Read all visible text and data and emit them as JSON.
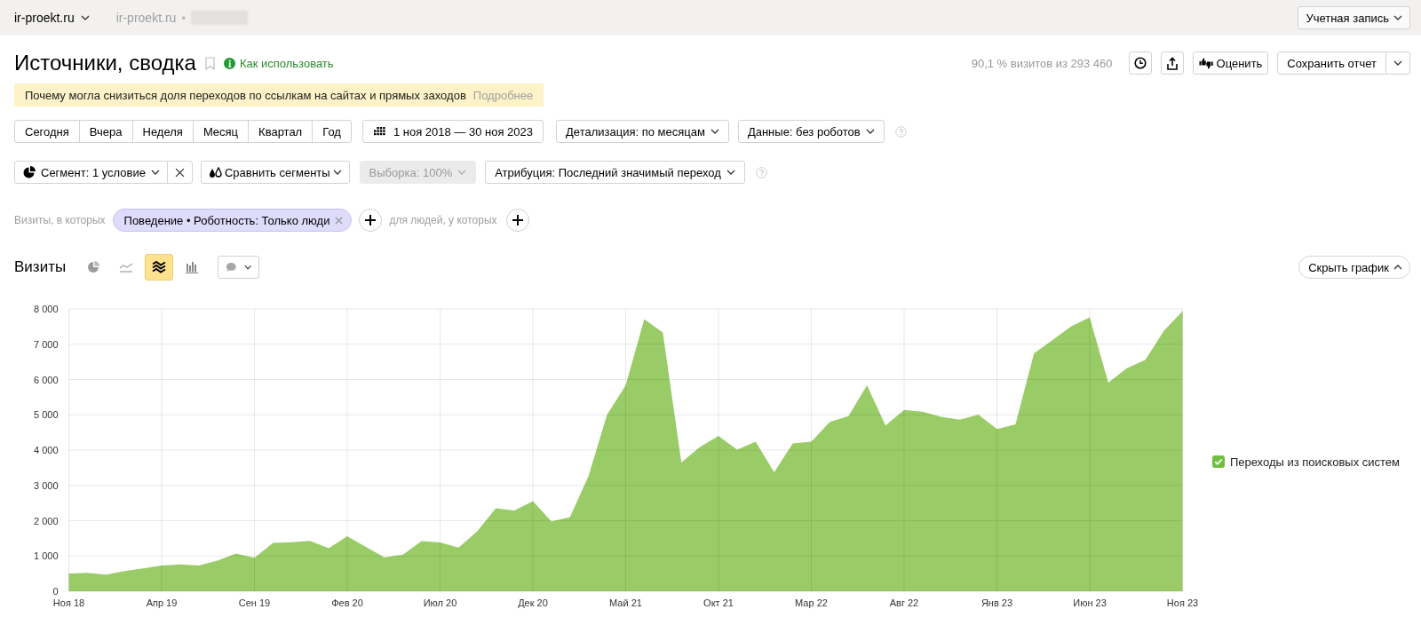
{
  "top_bar": {
    "site_selector": "ir-proekt.ru",
    "breadcrumb_site": "ir-proekt.ru",
    "breadcrumb_separator": "•",
    "account_button": "Учетная запись"
  },
  "header": {
    "title": "Источники, сводка",
    "help_link": "Как использовать",
    "sample_info": "90,1 % визитов из 293 460",
    "rate_button": "Оценить",
    "save_button": "Сохранить отчет"
  },
  "notice": {
    "text": "Почему могла снизиться доля переходов по ссылкам на сайтах и прямых заходов",
    "link": "Подробнее"
  },
  "periods": [
    {
      "label": "Сегодня",
      "selected": false
    },
    {
      "label": "Вчера",
      "selected": false
    },
    {
      "label": "Неделя",
      "selected": false
    },
    {
      "label": "Месяц",
      "selected": false
    },
    {
      "label": "Квартал",
      "selected": false
    },
    {
      "label": "Год",
      "selected": false
    }
  ],
  "date_range": "1 ноя 2018 — 30 ноя 2023",
  "filters": [
    "Детализация: по месяцам",
    "Данные: без роботов"
  ],
  "segment": "Сегмент: 1 условие",
  "compare_button": "Сравнить сегменты",
  "sample": {
    "label": "Выборка: 100%",
    "disabled": true
  },
  "attribution": "Атрибуция: Последний значимый переход",
  "conditions": {
    "visits_prefix": "Визиты, в которых",
    "chip": "Поведение • Роботность: Только люди",
    "people_prefix": "для людей, у которых"
  },
  "chart": {
    "title": "Визиты",
    "chart_types": [
      {
        "kind": "pie",
        "selected": false
      },
      {
        "kind": "line",
        "selected": false
      },
      {
        "kind": "area",
        "selected": true
      },
      {
        "kind": "bar",
        "selected": false
      }
    ],
    "hide_button": "Скрыть график",
    "legend": [
      {
        "checked": true
      }
    ],
    "chart_data": {
      "type": "area",
      "grid": true,
      "categories": [
        "Ноя 18",
        null,
        null,
        null,
        null,
        "Апр 19",
        null,
        null,
        null,
        null,
        "Сен 19",
        null,
        null,
        null,
        null,
        "Фев 20",
        null,
        null,
        null,
        null,
        "Июл 20",
        null,
        null,
        null,
        null,
        "Дек 20",
        null,
        null,
        null,
        null,
        "Май 21",
        null,
        null,
        null,
        null,
        "Окт 21",
        null,
        null,
        null,
        null,
        "Мар 22",
        null,
        null,
        null,
        null,
        "Авг 22",
        null,
        null,
        null,
        null,
        "Янв 23",
        null,
        null,
        null,
        null,
        "Июн 23",
        null,
        null,
        null,
        null,
        "Ноя 23"
      ],
      "series": [
        {
          "name": "Переходы из поисковых систем",
          "color": "#99cc66",
          "values": [
            500,
            520,
            470,
            570,
            650,
            730,
            760,
            730,
            870,
            1070,
            950,
            1370,
            1390,
            1430,
            1220,
            1560,
            1260,
            960,
            1040,
            1420,
            1380,
            1240,
            1700,
            2350,
            2290,
            2550,
            1980,
            2100,
            3270,
            5010,
            5840,
            7710,
            7330,
            3650,
            4090,
            4400,
            4010,
            4240,
            3370,
            4190,
            4240,
            4800,
            4960,
            5840,
            4700,
            5140,
            5090,
            4940,
            4860,
            5010,
            4600,
            4730,
            6740,
            7120,
            7510,
            7760,
            5910,
            6320,
            6560,
            7380,
            7940
          ]
        }
      ],
      "ylim": [
        0,
        8000
      ],
      "yticks": [
        {
          "value": 0,
          "label": "0"
        },
        {
          "value": 1000,
          "label": "1 000"
        },
        {
          "value": 2000,
          "label": "2 000"
        },
        {
          "value": 3000,
          "label": "3 000"
        },
        {
          "value": 4000,
          "label": "4 000"
        },
        {
          "value": 5000,
          "label": "5 000"
        },
        {
          "value": 6000,
          "label": "6 000"
        },
        {
          "value": 7000,
          "label": "7 000"
        },
        {
          "value": 8000,
          "label": "8 000"
        }
      ]
    }
  }
}
